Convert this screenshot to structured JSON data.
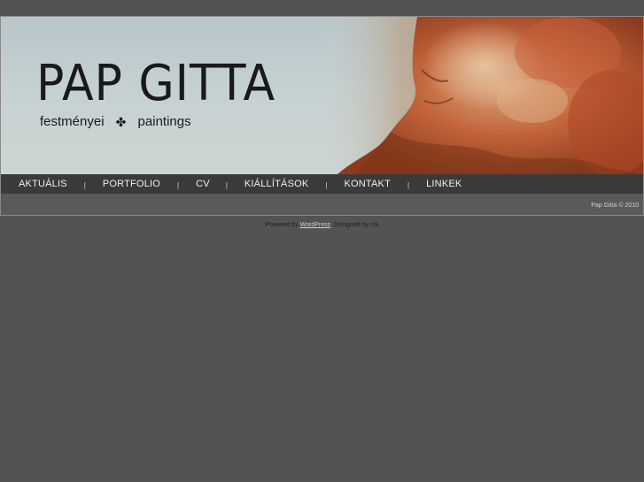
{
  "header": {
    "title": "PAP GITTA",
    "tagline_left": "festményei",
    "tagline_ornament": "✤",
    "tagline_right": "paintings"
  },
  "nav": {
    "items": [
      {
        "label": "AKTUÁLIS"
      },
      {
        "label": "PORTFOLIO"
      },
      {
        "label": "CV"
      },
      {
        "label": "KIÁLLÍTÁSOK"
      },
      {
        "label": "KONTAKT"
      },
      {
        "label": "LINKEK"
      }
    ],
    "separator": "|"
  },
  "footer": {
    "copyright": "Pap Gitta © 2010",
    "powered_prefix": "Powered by ",
    "powered_link": "WordPress",
    "powered_suffix": ". Designed by rck"
  },
  "colors": {
    "page_bg": "#535353",
    "nav_bg": "#3a3a3a",
    "banner_sky": "#c6d1d2",
    "painting_orange": "#c0502a"
  },
  "icons": {
    "tagline_ornament": "quatrefoil-ornament-icon"
  }
}
